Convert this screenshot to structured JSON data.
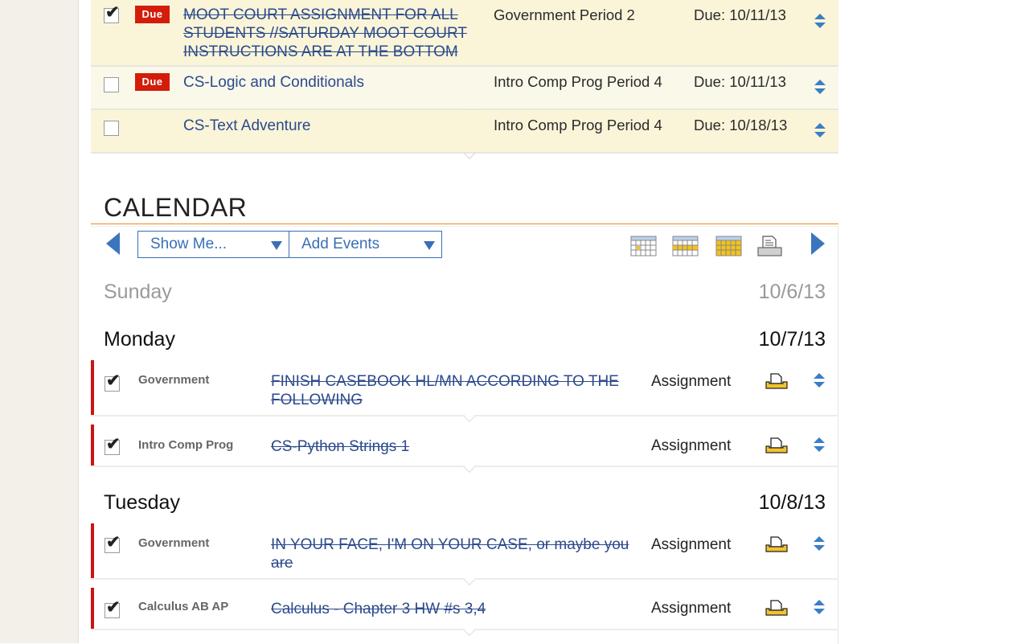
{
  "todo_list": {
    "items": [
      {
        "checked": true,
        "due_badge": "Due",
        "title": "MOOT COURT ASSIGNMENT FOR ALL STUDENTS //SATURDAY MOOT COURT INSTRUCTIONS ARE AT THE BOTTOM",
        "completed": true,
        "course": "Government Period 2",
        "due": "Due: 10/11/13"
      },
      {
        "checked": false,
        "due_badge": "Due",
        "title": "CS-Logic and Conditionals",
        "completed": false,
        "course": "Intro Comp Prog Period 4",
        "due": "Due: 10/11/13"
      },
      {
        "checked": false,
        "due_badge": null,
        "title": "CS-Text Adventure",
        "completed": false,
        "course": "Intro Comp Prog Period 4",
        "due": "Due: 10/18/13"
      }
    ]
  },
  "calendar": {
    "title": "CALENDAR",
    "toolbar": {
      "show_me_label": "Show Me...",
      "add_events_label": "Add Events",
      "views": [
        "day-view-icon",
        "week-view-icon",
        "month-view-icon",
        "print-icon"
      ]
    },
    "days": [
      {
        "name": "Sunday",
        "date": "10/6/13",
        "past": true,
        "events": []
      },
      {
        "name": "Monday",
        "date": "10/7/13",
        "past": false,
        "events": [
          {
            "checked": true,
            "course": "Government",
            "title": "FINISH CASEBOOK HL/MN ACCORDING TO THE FOLLOWING",
            "type": "Assignment"
          },
          {
            "checked": true,
            "course": "Intro Comp Prog",
            "title": "CS-Python Strings 1",
            "type": "Assignment"
          }
        ]
      },
      {
        "name": "Tuesday",
        "date": "10/8/13",
        "past": false,
        "events": [
          {
            "checked": true,
            "course": "Government",
            "title": "IN YOUR FACE, I'M ON YOUR CASE, or maybe you are",
            "type": "Assignment"
          },
          {
            "checked": true,
            "course": "Calculus AB AP",
            "title": "Calculus - Chapter 3 HW #s 3,4",
            "type": "Assignment"
          }
        ]
      }
    ]
  },
  "colors": {
    "link_blue": "#2c4a8c",
    "accent_blue": "#3a76bd",
    "due_red": "#d31d0a",
    "event_bar_red": "#cc1412",
    "rule_orange": "#e88a1a",
    "todo_bg": "#faf5d9"
  }
}
